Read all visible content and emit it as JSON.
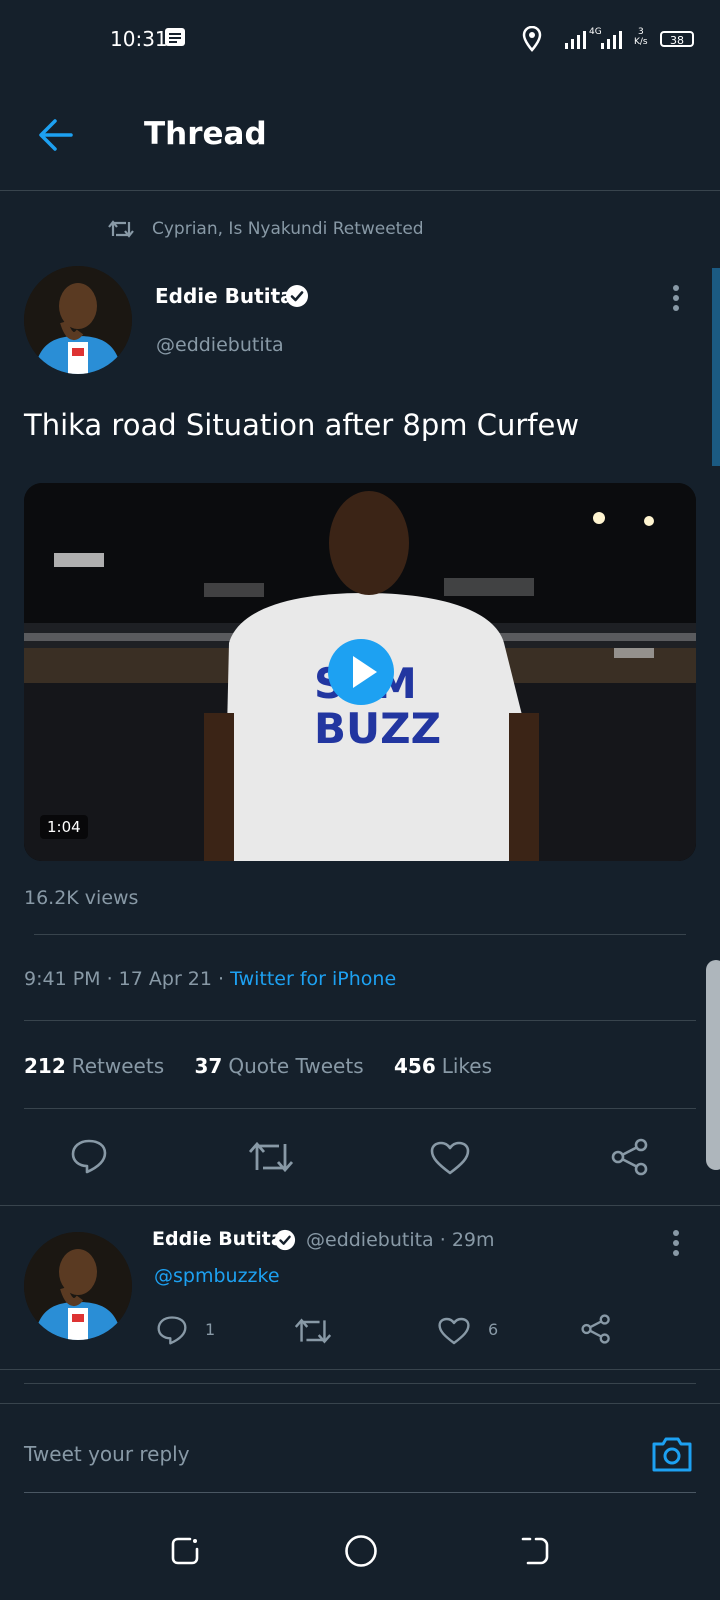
{
  "status_bar": {
    "time": "10:31",
    "network": "4G",
    "speed_value": "3",
    "speed_unit": "K/s",
    "battery": "38"
  },
  "header": {
    "title": "Thread"
  },
  "tweet": {
    "retweeted_by": "Cyprian, Is Nyakundi Retweeted",
    "author_name": "Eddie Butita",
    "author_handle": "@eddiebutita",
    "text": "Thika road Situation after 8pm Curfew",
    "video": {
      "duration": "1:04",
      "shirt_text_top": "SPM",
      "shirt_text_bottom": "BUZZ"
    },
    "views": "16.2K views",
    "time_date": "9:41 PM · 17 Apr 21 · ",
    "source": "Twitter for iPhone",
    "stats": [
      {
        "num": "212",
        "label": "Retweets"
      },
      {
        "num": "37",
        "label": "Quote Tweets"
      },
      {
        "num": "456",
        "label": "Likes"
      }
    ]
  },
  "reply": {
    "author_name": "Eddie Butita",
    "author_handle": "@eddiebutita · 29m",
    "text": "@spmbuzzke",
    "reply_count": "1",
    "like_count": "6"
  },
  "composer": {
    "placeholder": "Tweet your reply"
  },
  "colors": {
    "background": "#15202b",
    "accent": "#1da1f2",
    "muted": "#8899a6",
    "divider": "#38444d"
  }
}
